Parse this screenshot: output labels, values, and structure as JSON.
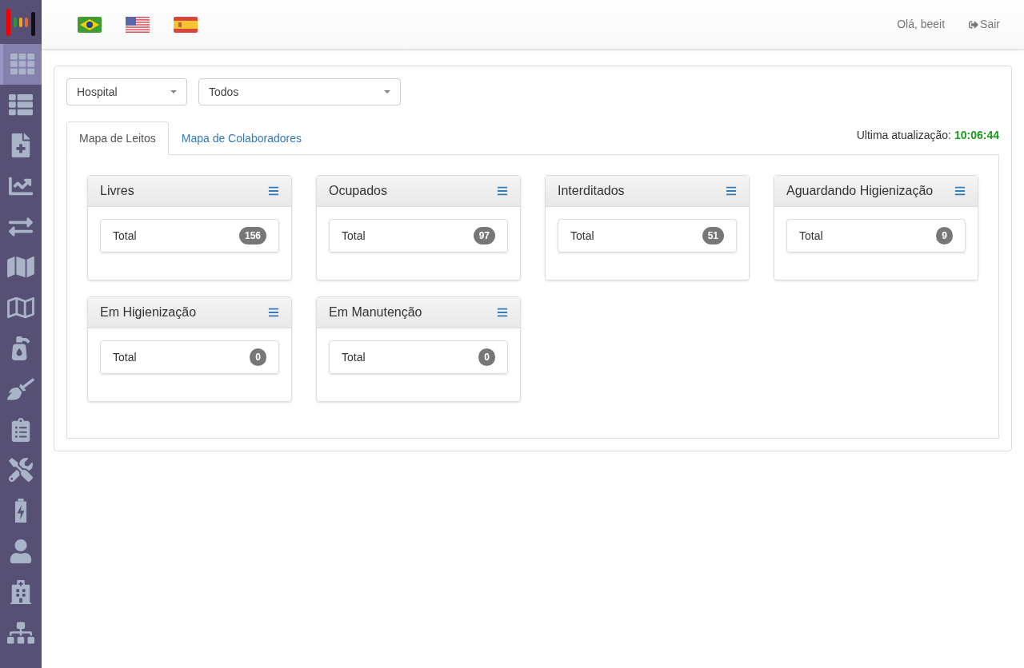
{
  "sidebar": {
    "items": [
      {
        "selected": true
      },
      {
        "selected": false
      },
      {
        "selected": false
      },
      {
        "selected": false
      },
      {
        "selected": false
      },
      {
        "selected": false
      },
      {
        "selected": false
      },
      {
        "selected": false
      },
      {
        "selected": false
      },
      {
        "selected": false
      },
      {
        "selected": false
      },
      {
        "selected": false
      },
      {
        "selected": false
      },
      {
        "selected": false
      },
      {
        "selected": false
      }
    ]
  },
  "header": {
    "greeting": "Olá, beeit",
    "logout": "Sair"
  },
  "filters": [
    {
      "value": "Hospital"
    },
    {
      "value": "Todos"
    }
  ],
  "tabs": [
    {
      "label": "Mapa de Leitos",
      "selected": true
    },
    {
      "label": "Mapa de Colaboradores",
      "selected": false
    }
  ],
  "last_update": {
    "label": "Ultima atualização:",
    "time": "10:06:44"
  },
  "cards": [
    {
      "title": "Livres",
      "row_label": "Total",
      "count": "156"
    },
    {
      "title": "Ocupados",
      "row_label": "Total",
      "count": "97"
    },
    {
      "title": "Interditados",
      "row_label": "Total",
      "count": "51"
    },
    {
      "title": "Aguardando Higienização",
      "row_label": "Total",
      "count": "9"
    },
    {
      "title": "Em Higienização",
      "row_label": "Total",
      "count": "0"
    },
    {
      "title": "Em Manutenção",
      "row_label": "Total",
      "count": "0"
    }
  ]
}
